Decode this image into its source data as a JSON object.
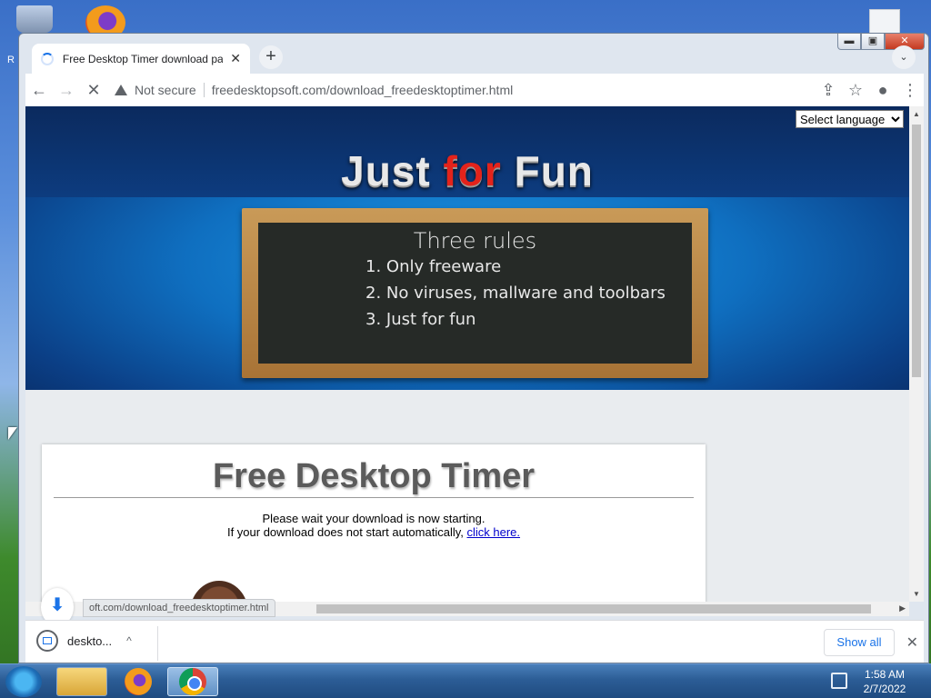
{
  "desktop": {
    "partial_label": "R"
  },
  "window": {
    "controls": {
      "minimize": "▬",
      "maximize": "▣",
      "close": "✕"
    }
  },
  "tab": {
    "title": "Free Desktop Timer download pa",
    "close": "✕",
    "new_tab": "+",
    "tab_search": "⌄"
  },
  "toolbar": {
    "back": "←",
    "forward": "→",
    "stop": "✕",
    "security_label": "Not secure",
    "url": "freedesktopsoft.com/download_freedesktoptimer.html",
    "share": "⇪",
    "bookmark": "☆",
    "profile": "●",
    "menu": "⋮"
  },
  "page": {
    "language_select": {
      "selected": "Select language",
      "options": [
        "Select language"
      ]
    },
    "banner": {
      "title_part1": "Just ",
      "title_part2": "for",
      "title_part3": " Fun"
    },
    "chalkboard": {
      "title": "Three rules",
      "rules": [
        "1. Only freeware",
        "2. No viruses, mallware and toolbars",
        "3. Just for fun"
      ]
    },
    "card": {
      "title": "Free Desktop Timer",
      "line1": "Please wait your download is now starting.",
      "line2": "If your download does not start automatically,",
      "link": "click here."
    }
  },
  "status_bar": {
    "url": "oft.com/download_freedesktoptimer.html"
  },
  "download_shelf": {
    "item_name": "deskto...",
    "show_all": "Show all",
    "close": "✕",
    "chevron": "^",
    "download_arrow": "⬇"
  },
  "taskbar": {
    "time": "1:58 AM",
    "date": "2/7/2022"
  }
}
